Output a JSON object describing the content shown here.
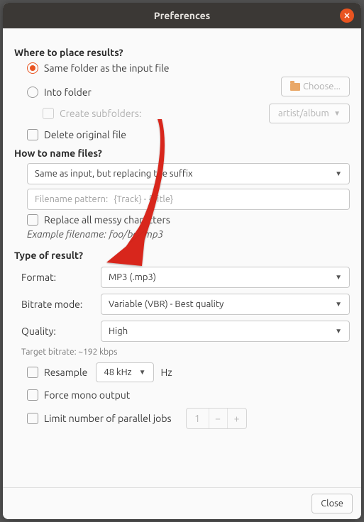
{
  "title": "Preferences",
  "sections": {
    "where": {
      "header": "Where to place results?",
      "same_folder": "Same folder as the input file",
      "into_folder": "Into folder",
      "choose_btn": "Choose...",
      "create_subfolders": "Create subfolders:",
      "subfolder_pattern": "artist/album",
      "delete_original": "Delete original file"
    },
    "naming": {
      "header": "How to name files?",
      "mode_selected": "Same as input, but replacing the suffix",
      "pattern_label": "Filename pattern:",
      "pattern_placeholder": "{Track} - {Title}",
      "replace_messy": "Replace all messy characters",
      "example_label": "Example filename:",
      "example_value": "foo/bar.mp3"
    },
    "result": {
      "header": "Type of result?",
      "format_label": "Format:",
      "format_value": "MP3 (.mp3)",
      "bitrate_mode_label": "Bitrate mode:",
      "bitrate_mode_value": "Variable (VBR) - Best quality",
      "quality_label": "Quality:",
      "quality_value": "High",
      "target_bitrate": "Target bitrate: ~192 kbps",
      "resample_label": "Resample",
      "resample_value": "48 kHz",
      "hz": "Hz",
      "force_mono": "Force mono output",
      "limit_jobs": "Limit number of parallel jobs",
      "jobs_value": "1"
    }
  },
  "footer": {
    "close": "Close"
  }
}
